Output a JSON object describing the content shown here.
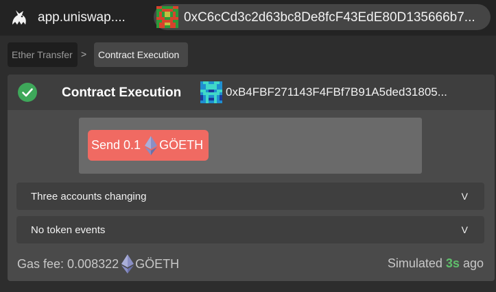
{
  "topbar": {
    "site_name": "app.uniswap....",
    "address": "0xC6cCd3c2d63bc8De8fcF43EdE80D135666b7..."
  },
  "breadcrumb": {
    "items": [
      {
        "label": "Ether Transfer"
      },
      {
        "label": "Contract Execution"
      }
    ],
    "separator": ">"
  },
  "card": {
    "title": "Contract Execution",
    "target_address": "0xB4FBF271143F4FBf7B91A5ded31805...",
    "send_prefix": "Send 0.1",
    "send_token": "GÖETH",
    "rows": [
      {
        "label": "Three accounts changing",
        "chevron": "V"
      },
      {
        "label": "No token events",
        "chevron": "V"
      }
    ],
    "gas_fee_label": "Gas fee: 0.008322",
    "gas_fee_token": "GÖETH",
    "simulated_prefix": "Simulated",
    "simulated_time": "3s",
    "simulated_suffix": "ago"
  },
  "colors": {
    "send_button": "#f06a62",
    "success_check": "#3ea85a",
    "time_green": "#5fbf6b",
    "eth_icon": "#7c82b8"
  },
  "icons": [
    "unicorn-logo",
    "address-blockie",
    "check-circle-icon",
    "target-blockie",
    "eth-icon"
  ]
}
